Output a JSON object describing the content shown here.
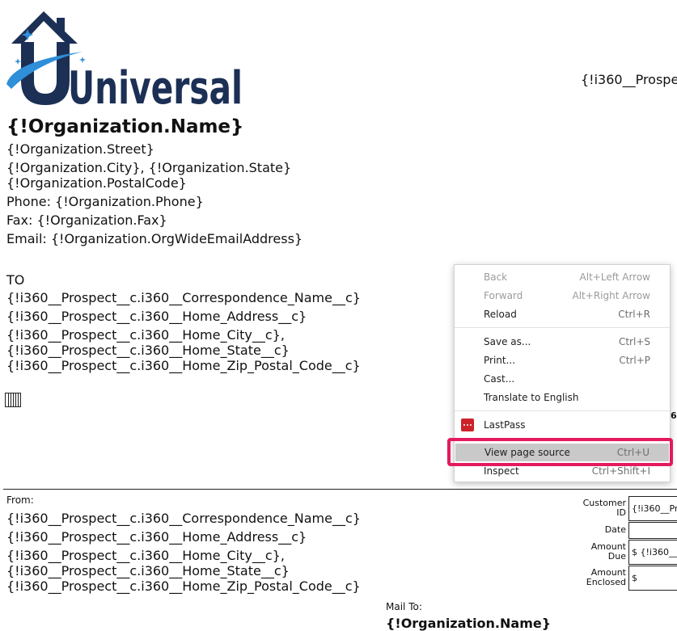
{
  "logo": {
    "text": "Universal"
  },
  "header_right": "{!i360__Prospe",
  "organization": {
    "name": "{!Organization.Name}",
    "street": "{!Organization.Street}",
    "city_state": "{!Organization.City}, {!Organization.State}",
    "postal": "{!Organization.PostalCode}",
    "phone": "Phone: {!Organization.Phone}",
    "fax": "Fax: {!Organization.Fax}",
    "email": "Email: {!Organization.OrgWideEmailAddress}"
  },
  "to_section": {
    "label": "TO",
    "lines": [
      "{!i360__Prospect__c.i360__Correspondence_Name__c}",
      "{!i360__Prospect__c.i360__Home_Address__c}",
      "{!i360__Prospect__c.i360__Home_City__c},",
      "{!i360__Prospect__c.i360__Home_State__c}",
      "{!i360__Prospect__c.i360__Home_Zip_Postal_Code__c}"
    ]
  },
  "right_fragments": {
    "a": "6",
    "b": ""
  },
  "from_section": {
    "label": "From:",
    "lines": [
      "{!i360__Prospect__c.i360__Correspondence_Name__c}",
      "{!i360__Prospect__c.i360__Home_Address__c}",
      "{!i360__Prospect__c.i360__Home_City__c},",
      "{!i360__Prospect__c.i360__Home_State__c}",
      "{!i360__Prospect__c.i360__Home_Zip_Postal_Code__c}"
    ]
  },
  "mail_to": {
    "label": "Mail To:",
    "org_name": "{!Organization.Name}"
  },
  "remit_form": {
    "customer_id_label": "Customer ID",
    "customer_id_value": "{!i360__Pr",
    "date_label": "Date",
    "date_value": "",
    "amount_due_label": "Amount Due",
    "amount_due_value": "$ {!i360__",
    "amount_enclosed_label": "Amount Enclosed",
    "amount_enclosed_value": "$"
  },
  "context_menu": {
    "items": [
      {
        "label": "Back",
        "shortcut": "Alt+Left Arrow"
      },
      {
        "label": "Forward",
        "shortcut": "Alt+Right Arrow"
      },
      {
        "label": "Reload",
        "shortcut": "Ctrl+R"
      },
      {
        "label": "Save as...",
        "shortcut": "Ctrl+S"
      },
      {
        "label": "Print...",
        "shortcut": "Ctrl+P"
      },
      {
        "label": "Cast...",
        "shortcut": ""
      },
      {
        "label": "Translate to English",
        "shortcut": ""
      },
      {
        "label": "LastPass",
        "shortcut": ""
      },
      {
        "label": "View page source",
        "shortcut": "Ctrl+U"
      },
      {
        "label": "Inspect",
        "shortcut": "Ctrl+Shift+I"
      }
    ]
  },
  "colors": {
    "logo_navy": "#1c2f55",
    "logo_blue": "#2f8fd8",
    "highlight_pink": "#e5195f",
    "lastpass_red": "#cc2229"
  }
}
